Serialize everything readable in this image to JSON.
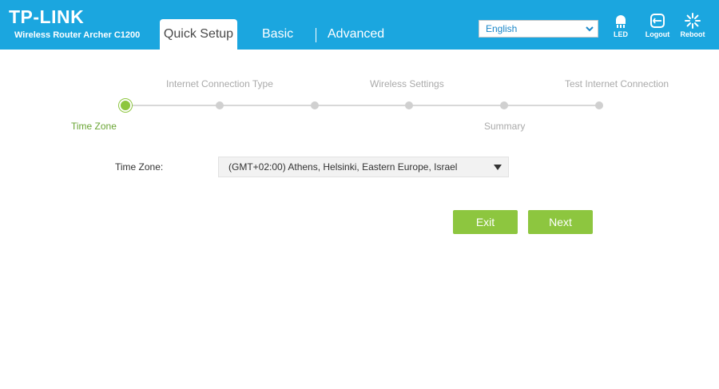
{
  "header": {
    "brand": "TP-LINK",
    "model": "Wireless Router Archer C1200",
    "tabs": [
      {
        "label": "Quick Setup",
        "active": true
      },
      {
        "label": "Basic",
        "active": false
      },
      {
        "label": "Advanced",
        "active": false
      }
    ],
    "language": {
      "selected": "English"
    },
    "icons": [
      {
        "name": "led-icon",
        "label": "LED"
      },
      {
        "name": "logout-icon",
        "label": "Logout"
      },
      {
        "name": "reboot-icon",
        "label": "Reboot"
      }
    ],
    "colors": {
      "header_bg": "#1ba6df",
      "accent_green": "#8dc63f"
    }
  },
  "wizard": {
    "steps_top": [
      "Internet Connection Type",
      "Wireless Settings",
      "Test Internet Connection"
    ],
    "steps_bottom": [
      "Time Zone",
      "Summary"
    ],
    "current_step": "Time Zone"
  },
  "form": {
    "timezone_label": "Time Zone:",
    "timezone_value": "(GMT+02:00) Athens, Helsinki, Eastern Europe, Israel"
  },
  "buttons": {
    "exit": "Exit",
    "next": "Next"
  }
}
